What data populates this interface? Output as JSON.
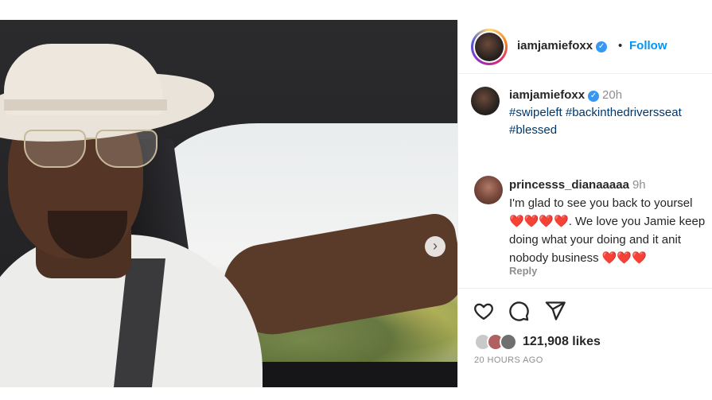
{
  "post": {
    "username": "iamjamiefoxx",
    "follow_label": "Follow",
    "separator": "•",
    "caption": {
      "username": "iamjamiefoxx",
      "time": "20h",
      "hashtags": "#swipeleft #backinthedriversseat #blessed"
    },
    "comment": {
      "username": "princesss_dianaaaaa",
      "time": "9h",
      "line1": "I'm glad to see you back to yoursel",
      "line2": "❤️❤️❤️❤️. We love you Jamie keep",
      "line3": "doing what your doing and it anit",
      "line4": "nobody business ❤️❤️❤️",
      "reply_label": "Reply"
    },
    "likes": "121,908 likes",
    "posted_ago": "20 HOURS AGO"
  },
  "colors": {
    "accent": "#0095f6",
    "verified": "#3897f0",
    "hashtag": "#00376b",
    "muted": "#8e8e8e"
  },
  "icons": {
    "verified": "verified-badge-icon",
    "next": "chevron-right-icon",
    "like": "heart-icon",
    "comment": "comment-bubble-icon",
    "share": "paper-plane-icon"
  }
}
